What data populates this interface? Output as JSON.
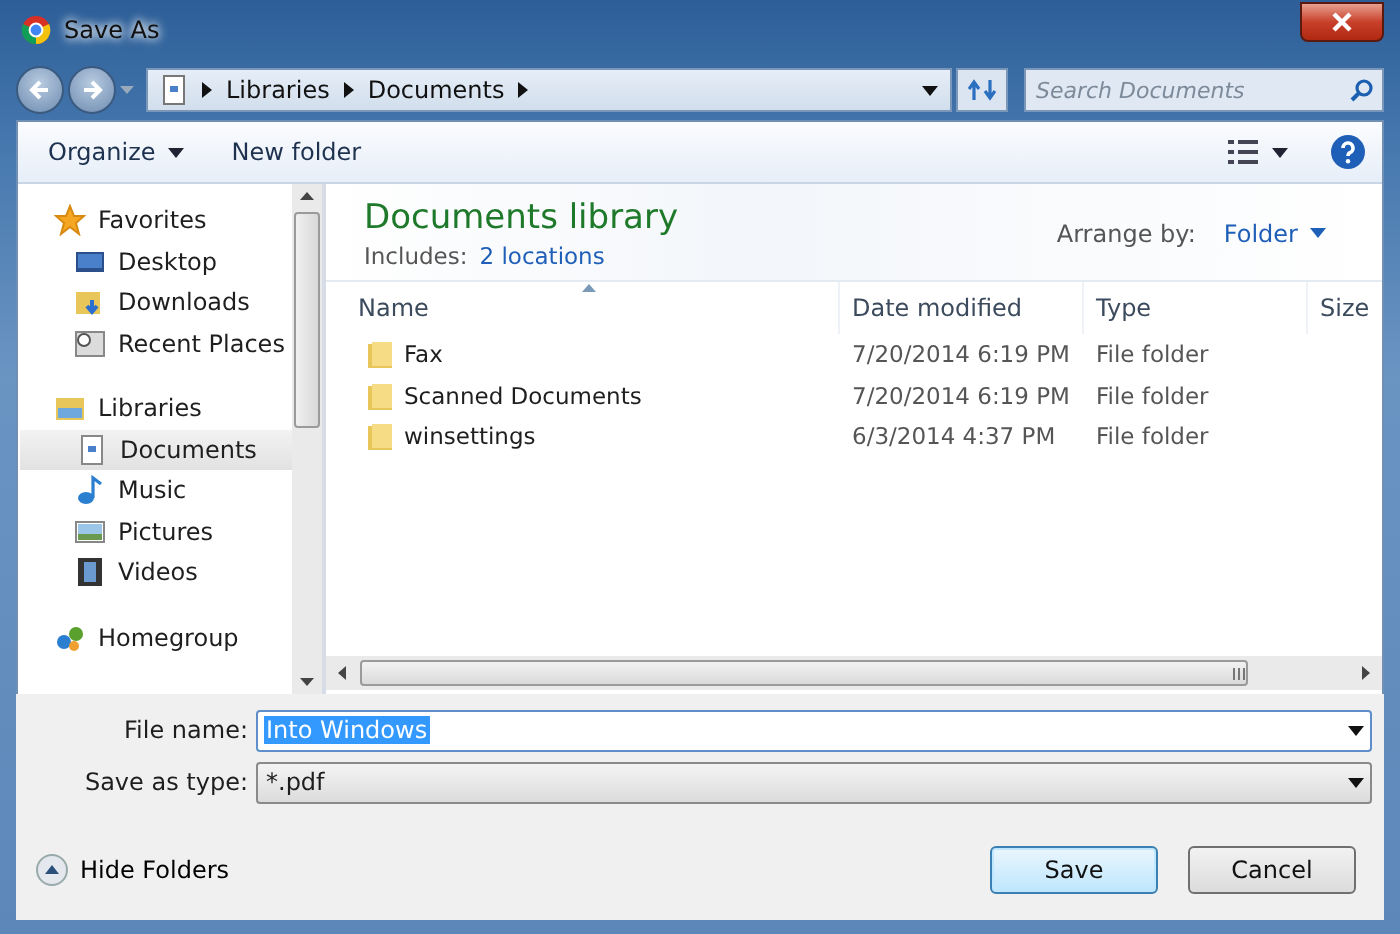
{
  "window": {
    "title": "Save As"
  },
  "address_bar": {
    "path": [
      "Libraries",
      "Documents"
    ]
  },
  "search": {
    "placeholder": "Search Documents"
  },
  "toolbar": {
    "organize": "Organize",
    "new_folder": "New folder"
  },
  "sidebar": {
    "items": [
      {
        "label": "Favorites",
        "kind": "favorites",
        "selected": false,
        "children": [
          {
            "label": "Desktop",
            "kind": "desktop",
            "selected": false
          },
          {
            "label": "Downloads",
            "kind": "downloads",
            "selected": false
          },
          {
            "label": "Recent Places",
            "kind": "recent",
            "selected": false
          }
        ]
      },
      {
        "label": "Libraries",
        "kind": "libraries",
        "selected": false,
        "children": [
          {
            "label": "Documents",
            "kind": "documents",
            "selected": true
          },
          {
            "label": "Music",
            "kind": "music",
            "selected": false
          },
          {
            "label": "Pictures",
            "kind": "pictures",
            "selected": false
          },
          {
            "label": "Videos",
            "kind": "videos",
            "selected": false
          }
        ]
      },
      {
        "label": "Homegroup",
        "kind": "homegroup",
        "selected": false
      }
    ]
  },
  "content": {
    "title": "Documents library",
    "includes_label": "Includes:",
    "includes_link": "2 locations",
    "arrange_label": "Arrange by:",
    "arrange_value": "Folder",
    "columns": [
      "Name",
      "Date modified",
      "Type",
      "Size"
    ],
    "rows": [
      {
        "name": "Fax",
        "date": "7/20/2014 6:19 PM",
        "type": "File folder"
      },
      {
        "name": "Scanned Documents",
        "date": "7/20/2014 6:19 PM",
        "type": "File folder"
      },
      {
        "name": "winsettings",
        "date": "6/3/2014 4:37 PM",
        "type": "File folder"
      }
    ]
  },
  "form": {
    "file_name": {
      "label": "File name:",
      "value": "Into Windows",
      "selected": true
    },
    "save_type": {
      "label": "Save as type:",
      "value": "*.pdf"
    }
  },
  "hide_folders": "Hide Folders",
  "buttons": [
    {
      "label": "Save",
      "default": true
    },
    {
      "label": "Cancel",
      "default": false
    }
  ]
}
